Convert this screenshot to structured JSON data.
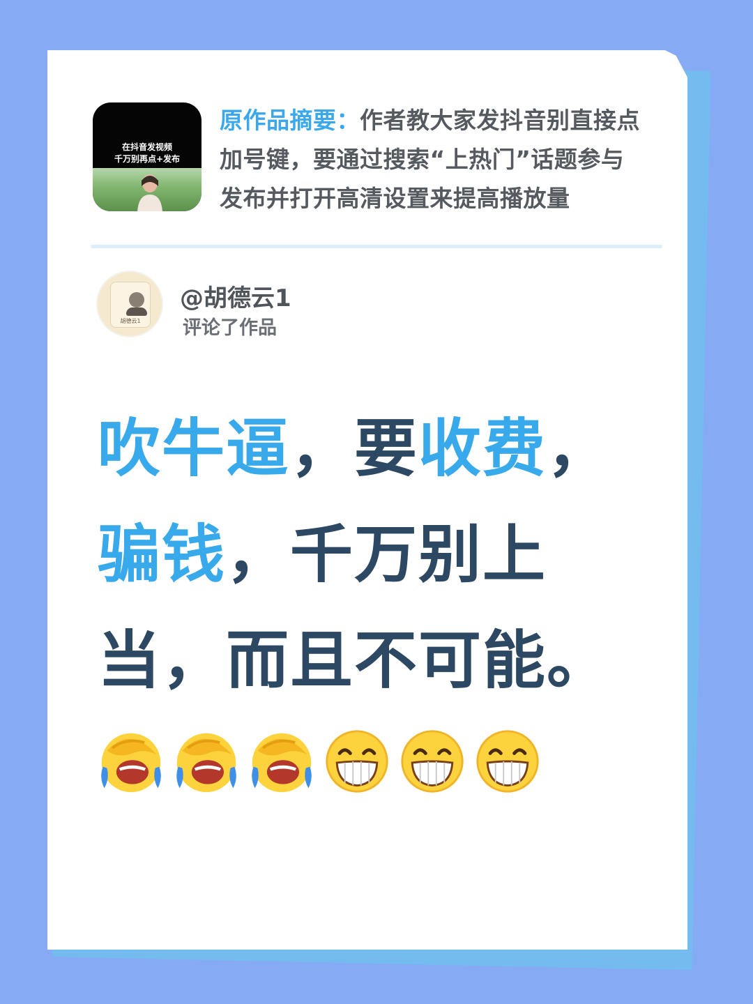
{
  "summary": {
    "label": "原作品摘要：",
    "text": "作者教大家发抖音别直接点加号键，要通过搜索“上热门”话题参与发布并打开高清设置来提高播放量",
    "thumbnail_line1": "在抖音发视频",
    "thumbnail_line2": "千万别再点+发布"
  },
  "commenter": {
    "username": "@胡德云1",
    "action": "评论了作品",
    "avatar_caption": "胡德云1"
  },
  "comment": {
    "segments": [
      {
        "text": "吹牛逼",
        "highlight": true
      },
      {
        "text": "，要",
        "highlight": false
      },
      {
        "text": "收费",
        "highlight": true
      },
      {
        "text": "，",
        "highlight": false
      },
      {
        "text": "骗钱",
        "highlight": true
      },
      {
        "text": "，千万别上当，而且不可能。",
        "highlight": false
      }
    ]
  },
  "emojis": [
    "facepalm-laugh",
    "facepalm-laugh",
    "facepalm-laugh",
    "grin",
    "grin",
    "grin"
  ],
  "colors": {
    "background": "#86aaf4",
    "paper_edge": "#74bcf0",
    "accent": "#38a9ea",
    "comment_text": "#2d4862"
  }
}
